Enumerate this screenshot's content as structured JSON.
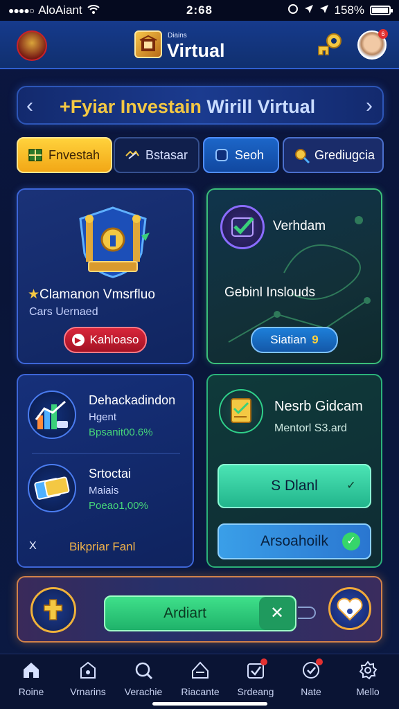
{
  "status_bar": {
    "carrier": "AloAiant",
    "time": "2:68",
    "battery": "158%",
    "battery_level": 0.9
  },
  "header": {
    "brand_small": "Diains",
    "brand": "Virtual",
    "icons": [
      "emblem-avatar",
      "app-logo",
      "key-icon",
      "user-avatar"
    ],
    "user_badge": "6"
  },
  "banner": {
    "title_part1": "+Fyiar Investain",
    "title_part2": "Wirill Virtual"
  },
  "tabs": [
    {
      "label": "Fnvestah",
      "icon": "grid-icon"
    },
    {
      "label": "Bstasar",
      "icon": "handshake-icon"
    },
    {
      "label": "Seoh",
      "icon": "square-icon"
    },
    {
      "label": "Grediugcia",
      "icon": "magnifier-icon"
    }
  ],
  "cards": {
    "investment": {
      "title": "Clamanon Vmsrfluo",
      "prefix": "★",
      "subtitle": "Cars Uernaed",
      "button": "Kahloaso"
    },
    "verification": {
      "title": "Verhdam",
      "middle": "Gebinl Inslouds",
      "button": "Siatian",
      "button_num": "9"
    },
    "stats": {
      "items": [
        {
          "title": "Dehackadindon",
          "sub": "Hgent",
          "value": "Bpsanit00.6%"
        },
        {
          "title": "Srtoctai",
          "sub": "Maiais",
          "value": "Poeao1,00%"
        }
      ],
      "footer_x": "X",
      "footer": "Bikpriar Fanl"
    },
    "news": {
      "title": "Nesrb Gidcam",
      "subtitle": "Mentorl S3.ard",
      "button1": "S Dlanl",
      "button2": "Arsoahoilk"
    },
    "action": {
      "slider_label": "Ardiart",
      "knob": "✕"
    }
  },
  "bottom_nav": [
    {
      "label": "Roine",
      "icon": "home-icon"
    },
    {
      "label": "Vrnarins",
      "icon": "bag-icon"
    },
    {
      "label": "Verachie",
      "icon": "search-icon"
    },
    {
      "label": "Riacante",
      "icon": "tray-icon"
    },
    {
      "label": "Srdeang",
      "icon": "check-box-icon"
    },
    {
      "label": "Nate",
      "icon": "heart-check-icon"
    },
    {
      "label": "Mello",
      "icon": "gear-icon"
    }
  ],
  "colors": {
    "accent_gold": "#f4c843",
    "accent_green": "#3fe08a",
    "accent_blue": "#1c66c8",
    "danger_red": "#d8263a"
  }
}
